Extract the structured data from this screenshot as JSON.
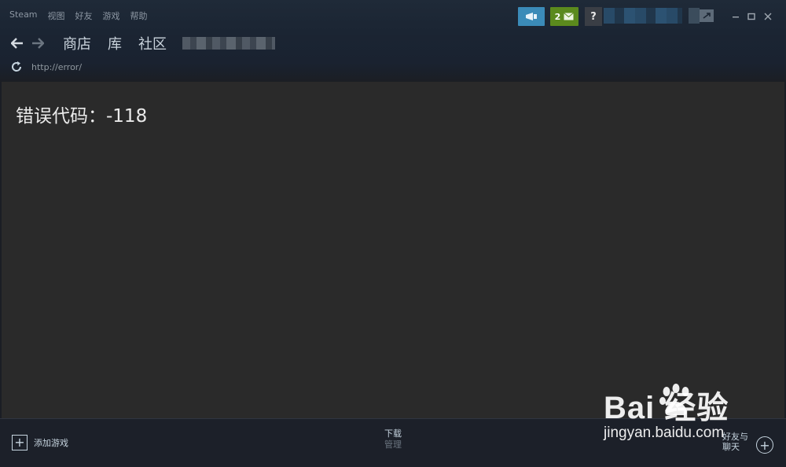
{
  "menu": {
    "items": [
      "Steam",
      "视图",
      "好友",
      "游戏",
      "帮助"
    ]
  },
  "topbar": {
    "notifications_count": "2",
    "help_label": "?"
  },
  "nav": {
    "links": [
      "商店",
      "库",
      "社区"
    ]
  },
  "address": {
    "url": "http://error/"
  },
  "content": {
    "error_text": "错误代码：-118"
  },
  "bottom": {
    "add_game_label": "添加游戏",
    "downloads_title": "下载",
    "downloads_subtitle": "管理",
    "friends_line1": "好友与",
    "friends_line2": "聊天"
  },
  "watermark": {
    "logo_text": "Bai  经验",
    "url_text": "jingyan.baidu.com"
  },
  "colors": {
    "announce_button": "#3b8bb8",
    "notification_button": "#5b8a1d",
    "content_background": "#2a2a2a"
  }
}
